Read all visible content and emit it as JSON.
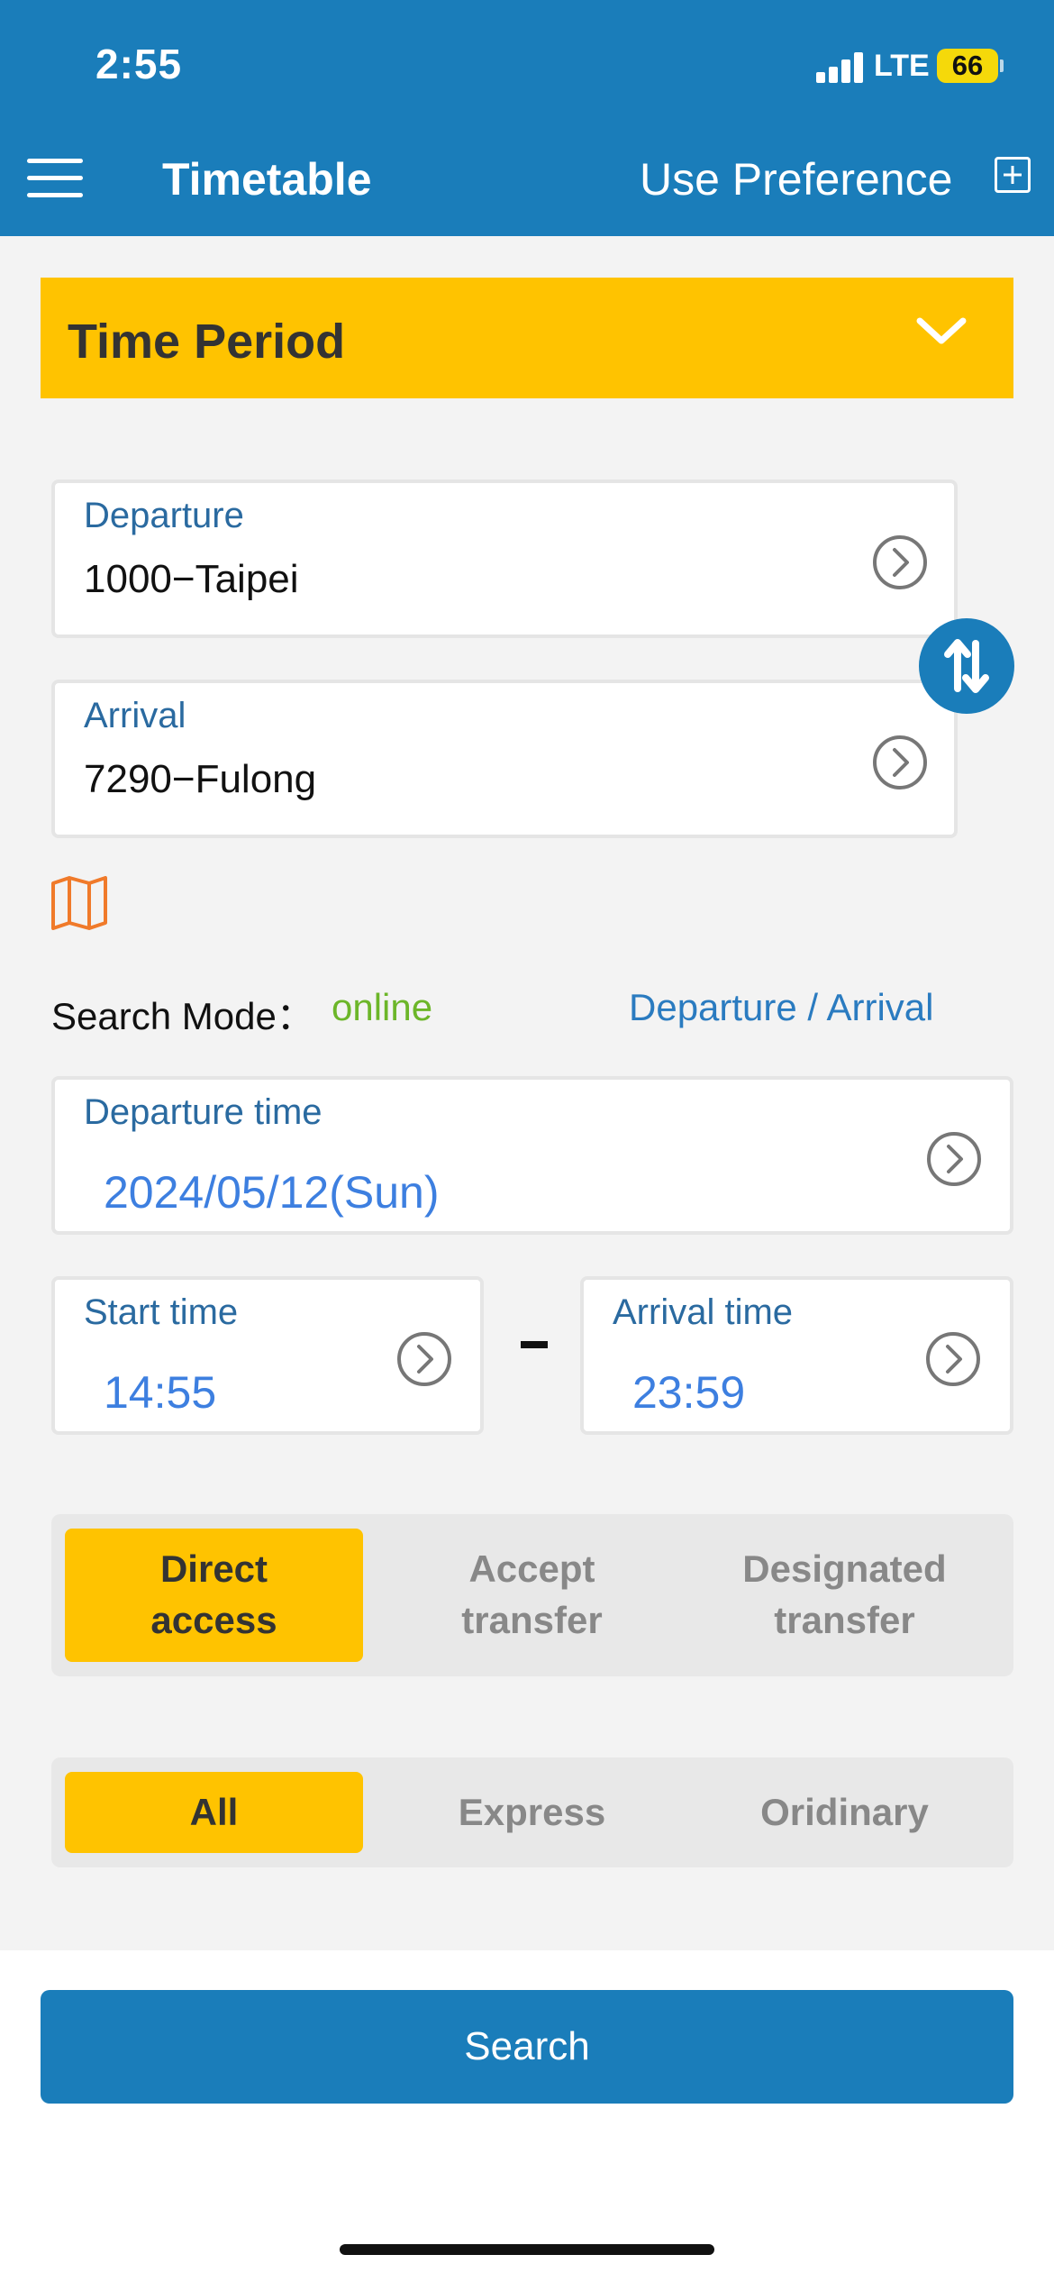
{
  "status": {
    "time": "2:55",
    "network": "LTE",
    "battery": "66"
  },
  "header": {
    "title": "Timetable",
    "preference": "Use Preference"
  },
  "period": {
    "label": "Time Period"
  },
  "departure": {
    "label": "Departure",
    "value": "1000−Taipei"
  },
  "arrival": {
    "label": "Arrival",
    "value": "7290−Fulong"
  },
  "search_mode": {
    "label": "Search Mode：",
    "value": "online",
    "toggle": "Departure / Arrival"
  },
  "departure_time": {
    "label": "Departure time",
    "value": "2024/05/12(Sun)"
  },
  "start_time": {
    "label": "Start time",
    "value": "14:55"
  },
  "arrival_time": {
    "label": "Arrival time",
    "value": "23:59"
  },
  "transfer_options": [
    {
      "line1": "Direct",
      "line2": "access",
      "active": true
    },
    {
      "line1": "Accept",
      "line2": "transfer",
      "active": false
    },
    {
      "line1": "Designated",
      "line2": "transfer",
      "active": false
    }
  ],
  "train_type_options": [
    {
      "label": "All",
      "active": true
    },
    {
      "label": "Express",
      "active": false
    },
    {
      "label": "Oridinary",
      "active": false
    }
  ],
  "search_button": "Search",
  "colors": {
    "brand": "#1a7dba",
    "accent": "#ffc300",
    "online": "#6cb629",
    "link": "#2a7bc0",
    "map": "#f07a2a"
  },
  "icons": [
    "menu-icon",
    "add-box-icon",
    "chevron-down-icon",
    "circle-chevron-right-icon",
    "swap-vertical-icon",
    "map-icon"
  ]
}
